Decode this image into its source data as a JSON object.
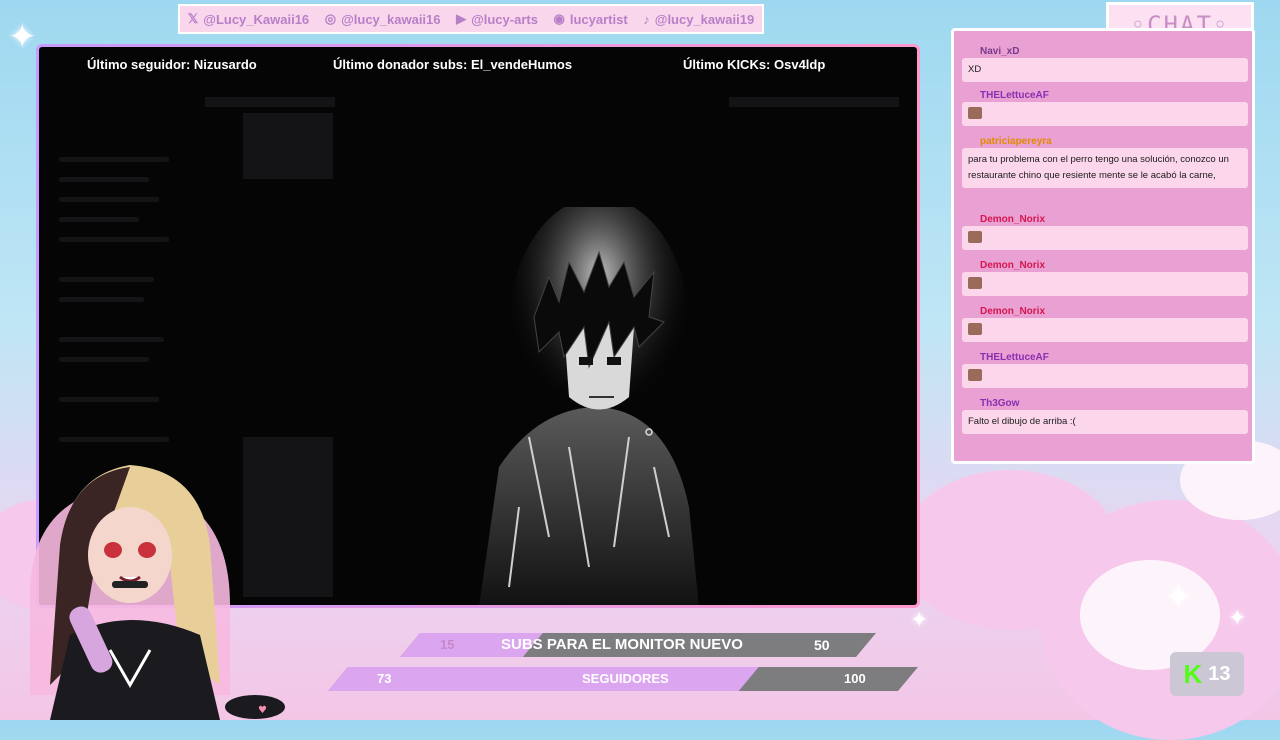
{
  "social": [
    {
      "icon": "x-icon",
      "glyph": "𝕏",
      "handle": "@Lucy_Kawaii16"
    },
    {
      "icon": "instagram-icon",
      "glyph": "◎",
      "handle": "@lucy_kawaii16"
    },
    {
      "icon": "youtube-icon",
      "glyph": "▶",
      "handle": "@lucy-arts"
    },
    {
      "icon": "discord-icon",
      "glyph": "◉",
      "handle": "lucyartist"
    },
    {
      "icon": "tiktok-icon",
      "glyph": "♪",
      "handle": "@lucy_kawaii19"
    }
  ],
  "stats": {
    "follower": "Último seguidor: Nizusardo",
    "donor": "Último donador subs: El_vendeHumos",
    "kicks": "Último KICKs: Osv4ldp"
  },
  "chat": {
    "title": "◦CHAT◦",
    "messages": [
      {
        "user": "Navi_xD",
        "color": "#7a3a8a",
        "text": "XD",
        "emote": false
      },
      {
        "user": "THELettuceAF",
        "color": "#8a2fb0",
        "text": "",
        "emote": true
      },
      {
        "user": "patriciapereyra",
        "color": "#e38a00",
        "text": "para tu problema con el perro tengo una solución, conozco un restaurante chino que resiente mente se le acabó la carne,",
        "emote": false
      },
      {
        "user": "Demon_Norix",
        "color": "#d6164f",
        "text": "",
        "emote": true
      },
      {
        "user": "Demon_Norix",
        "color": "#d6164f",
        "text": "",
        "emote": true
      },
      {
        "user": "Demon_Norix",
        "color": "#d6164f",
        "text": "",
        "emote": true
      },
      {
        "user": "THELettuceAF",
        "color": "#8a2fb0",
        "text": "",
        "emote": true
      },
      {
        "user": "Th3Gow",
        "color": "#8a2fb0",
        "text": "Falto el dibujo de arriba :(",
        "emote": false
      }
    ]
  },
  "goals": {
    "subs": {
      "current": "15",
      "label": "SUBS PARA EL MONITOR NUEVO",
      "target": "50",
      "progress": 0.3
    },
    "followers": {
      "current": "73",
      "label": "SEGUIDORES",
      "target": "100",
      "progress": 0.73
    }
  },
  "kick": {
    "logo": "K",
    "count": "13"
  },
  "colors": {
    "accent": "#dba6ef",
    "frame_start": "#c79bff",
    "frame_end": "#ff99cc",
    "chat_bg": "#e9a0d3"
  }
}
